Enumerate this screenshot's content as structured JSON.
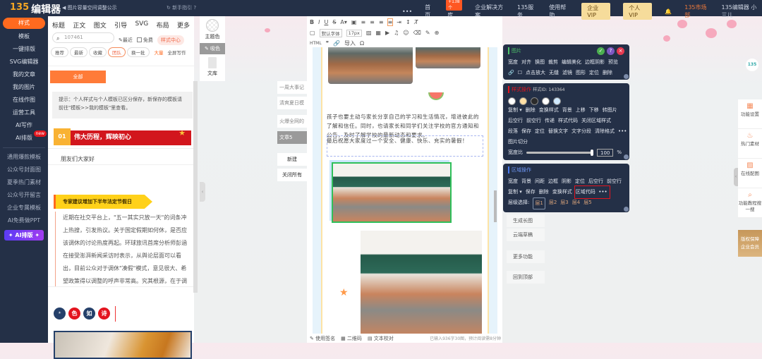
{
  "topbar": {
    "logo_num": "135",
    "logo_text": "编辑器",
    "notice": "◀ 图片容量空间调整公示",
    "guide": "↻  新手指引 ?",
    "more": "•••",
    "nav": [
      "首页",
      "素材库",
      "企业解决方案",
      "135服务",
      "使用帮助"
    ],
    "nav_badge": "+138个",
    "vip_enterprise": "企业VIP",
    "vip_personal": "个人VIP",
    "market": "135市场部",
    "user": "135编辑器 小三儿"
  },
  "sidebar": {
    "items": [
      "样式",
      "模板",
      "一键排版",
      "SVG编辑器",
      "我的文章",
      "我的图片",
      "在线作图",
      "运营工具",
      "AI写作",
      "AI排版"
    ],
    "new_badge": "new",
    "items2": [
      "通用爆款模板",
      "公众号封面图",
      "夏季热门素材",
      "公众号开留言",
      "企业专属模板",
      "AI免费做PPT"
    ],
    "ai_button": "✦ AI排版 ✦"
  },
  "stylepanel": {
    "tabs": [
      "标题",
      "正文",
      "图文",
      "引导",
      "SVG",
      "布局",
      "更多"
    ],
    "search_value": "107461",
    "recent": "最近",
    "free": "免费",
    "style_center": "样式中心",
    "filters": [
      "推荐",
      "最新",
      "收藏",
      "团队",
      "换一批"
    ],
    "lots": "大量",
    "fullscreen": "全屏写作",
    "all": "全部",
    "tip": "提示：个人样式与个人模板已区分保存，新保存的模板请前往\"模板>>我的模板\"里查看。",
    "title_num": "01",
    "title_text": "伟大历程，辉映初心",
    "hello": "朋友们大家好",
    "expert": "专家建议增加下半年法定节假日",
    "para": "近期在社交平台上，\"五一其实只放一天\"的词条冲上热搜，引发热议。关于国定假期如何休，是否应该调休的讨论热度再起。环球旅讯首席分析师彭涵在接受澎湃新闻采访时表示，从舆论层面可以看出，目前公众对于调休\"凑假\"模式，意见很大、希望政策得以调整的呼声非常高。究其根源，在于调休",
    "chars": [
      "色",
      "如",
      "诗"
    ]
  },
  "col2": {
    "theme": "主题色",
    "pick": "✎ 吸色",
    "library": "文库"
  },
  "articles": [
    "一周大事记",
    "清爽夏日模",
    "火爆全网的",
    "文章5",
    "新建",
    "关闭所有"
  ],
  "editor": {
    "font": "默认字体",
    "size": "17px",
    "import": "导入",
    "html": "HTML",
    "body_text": "孩子也要主动与家长分享自己的学习和生活情况，增进彼此的了解和信任。同时，也请家长和同学们关注学校的官方通知和公告，及时了解学校的最新动态和要求。",
    "closing": "最后祝愿大家度过一个安全、健康、快乐、充实的暑假！",
    "sign": "✎ 使用签名",
    "qrcode": "▦ 二维码",
    "proof": "▤ 文本校对",
    "count": "已输入936字30图，预计阅读需8分钟"
  },
  "image_panel": {
    "title": "图片",
    "row1": [
      "宽度",
      "对齐",
      "换图",
      "裁剪",
      "编辑美化",
      "边框阴影",
      "预览"
    ],
    "row2": [
      "点击放大",
      "无缝",
      "滤镜",
      "图形",
      "定位",
      "删除"
    ]
  },
  "style_panel": {
    "title": "样式操作",
    "id": "样式ID: 143364",
    "colors": [
      "#ffffff",
      "#ffe0a6",
      "#2b2b2b",
      "#ffffff",
      "#cfe9ff"
    ],
    "row1": [
      "复制 ▾",
      "删除",
      "变换样式",
      "背景",
      "上移",
      "下移",
      "转图片"
    ],
    "row2": [
      "后空行",
      "前空行",
      "传递",
      "样式代码",
      "关闭区域样式"
    ],
    "row3": [
      "段落",
      "保存",
      "定位",
      "替换文字",
      "文字分段",
      "清除格式",
      "•••"
    ],
    "row4": [
      "图片切分"
    ],
    "ratio_label": "宽度比",
    "ratio_value": "100",
    "ratio_unit": "%",
    "ratio": 1.0
  },
  "area_panel": {
    "title": "区域操作",
    "row1": [
      "宽度",
      "背景",
      "间距",
      "边框",
      "阴影",
      "定位",
      "后空行",
      "前空行"
    ],
    "row2": [
      "复制 ▾",
      "保存",
      "删除",
      "变换样式"
    ],
    "area_code": "区域代码",
    "more": "•••",
    "level_label": "层级选择:",
    "levels": [
      "层1",
      "层2",
      "层3",
      "层4",
      "层5"
    ]
  },
  "side_buttons": [
    "生成长图",
    "云端草稿",
    "更多功能",
    "回到顶部"
  ],
  "right_panel": {
    "items": [
      "功能设置",
      "热门素材",
      "在线配图",
      "功能教程搜一搜"
    ],
    "vip": [
      "版权保障",
      "企业会员"
    ]
  }
}
